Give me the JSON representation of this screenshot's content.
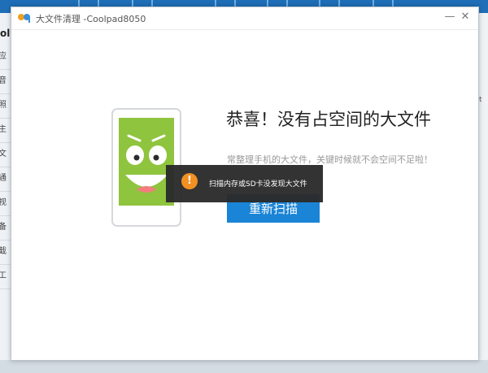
{
  "background_app": {
    "brand_fragment": "olp",
    "sidebar_fragments": [
      "应",
      "音",
      "照",
      "主",
      "文",
      "通",
      "视",
      "备",
      "截",
      "工"
    ],
    "right_fragment": "t"
  },
  "dialog": {
    "title": "大文件清理 -Coolpad8050",
    "minimize_label": "—",
    "close_label": "✕",
    "headline": "恭喜！没有占空间的大文件",
    "subline": "常整理手机的大文件，关键时候就不会空间不足啦！",
    "rescan_label": "重新扫描"
  },
  "toast": {
    "icon_glyph": "!",
    "message": "扫描内存或SD卡没发现大文件"
  },
  "colors": {
    "accent": "#1a84d6",
    "illustration_green": "#8fc43e",
    "warning": "#f28c1a"
  }
}
